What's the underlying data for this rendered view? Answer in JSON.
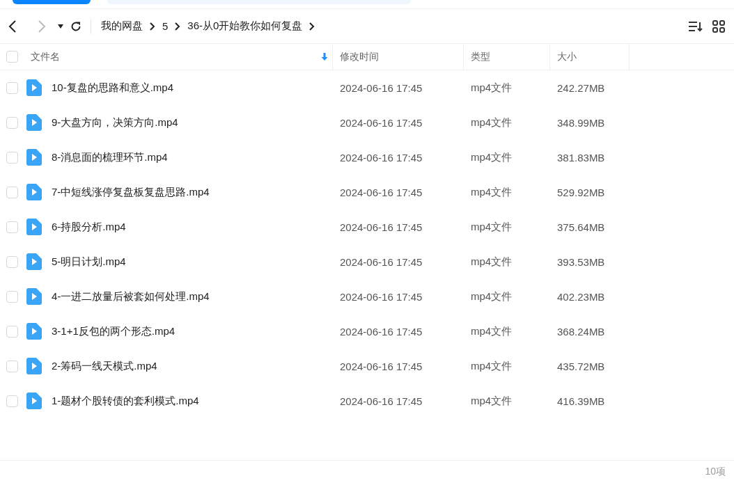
{
  "breadcrumb": [
    "我的网盘",
    "5",
    "36-从0开始教你如何复盘"
  ],
  "columns": [
    {
      "label": "文件名",
      "sorted": true
    },
    {
      "label": "修改时间",
      "sorted": false
    },
    {
      "label": "类型",
      "sorted": false
    },
    {
      "label": "大小",
      "sorted": false
    }
  ],
  "select_all": {
    "checked": false
  },
  "rows": [
    {
      "name": "10-复盘的思路和意义.mp4",
      "modified": "2024-06-16 17:45",
      "type": "mp4文件",
      "size": "242.27MB",
      "checked": false
    },
    {
      "name": "9-大盘方向，决策方向.mp4",
      "modified": "2024-06-16 17:45",
      "type": "mp4文件",
      "size": "348.99MB",
      "checked": false
    },
    {
      "name": "8-消息面的梳理环节.mp4",
      "modified": "2024-06-16 17:45",
      "type": "mp4文件",
      "size": "381.83MB",
      "checked": false
    },
    {
      "name": "7-中短线涨停复盘板复盘思路.mp4",
      "modified": "2024-06-16 17:45",
      "type": "mp4文件",
      "size": "529.92MB",
      "checked": false
    },
    {
      "name": "6-持股分析.mp4",
      "modified": "2024-06-16 17:45",
      "type": "mp4文件",
      "size": "375.64MB",
      "checked": false
    },
    {
      "name": "5-明日计划.mp4",
      "modified": "2024-06-16 17:45",
      "type": "mp4文件",
      "size": "393.53MB",
      "checked": false
    },
    {
      "name": "4-一进二放量后被套如何处理.mp4",
      "modified": "2024-06-16 17:45",
      "type": "mp4文件",
      "size": "402.23MB",
      "checked": false
    },
    {
      "name": "3-1+1反包的两个形态.mp4",
      "modified": "2024-06-16 17:45",
      "type": "mp4文件",
      "size": "368.24MB",
      "checked": false
    },
    {
      "name": "2-筹码一线天模式.mp4",
      "modified": "2024-06-16 17:45",
      "type": "mp4文件",
      "size": "435.72MB",
      "checked": false
    },
    {
      "name": "1-题材个股转债的套利模式.mp4",
      "modified": "2024-06-16 17:45",
      "type": "mp4文件",
      "size": "416.39MB",
      "checked": false
    }
  ],
  "status_bar": {
    "count": "10项"
  }
}
